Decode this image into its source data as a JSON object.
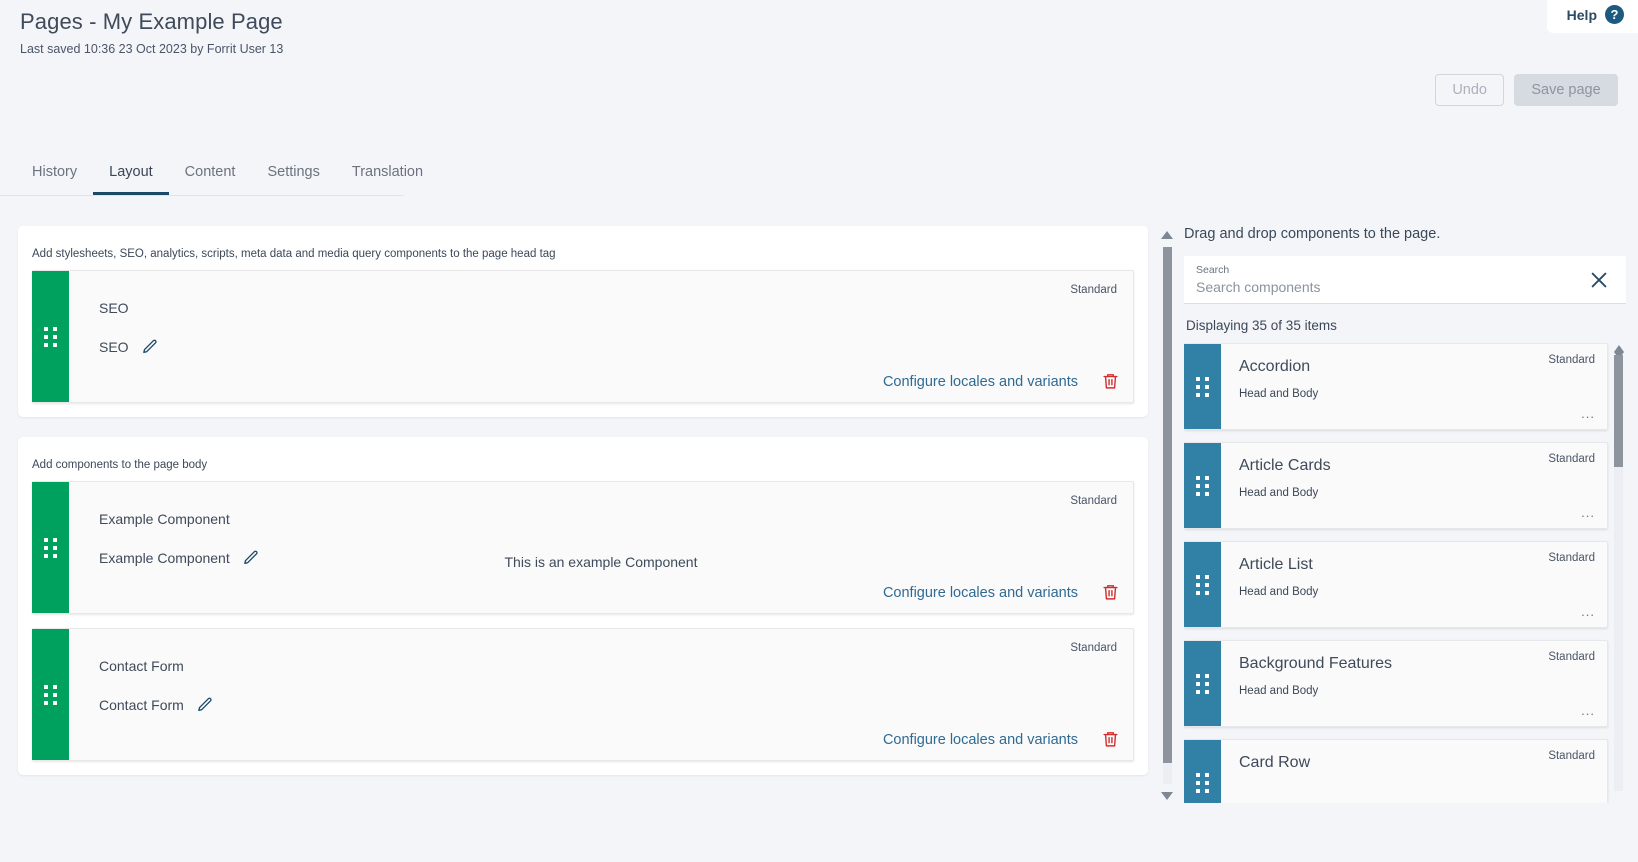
{
  "header": {
    "title": "Pages - My Example Page",
    "subtitle": "Last saved 10:36 23 Oct 2023 by Forrit User 13",
    "help_label": "Help",
    "help_icon_glyph": "?"
  },
  "actions": {
    "undo_label": "Undo",
    "save_label": "Save page"
  },
  "tabs": [
    {
      "label": "History",
      "active": false
    },
    {
      "label": "Layout",
      "active": true
    },
    {
      "label": "Content",
      "active": false
    },
    {
      "label": "Settings",
      "active": false
    },
    {
      "label": "Translation",
      "active": false
    }
  ],
  "sections": [
    {
      "hint": "Add stylesheets, SEO, analytics, scripts, meta data and media query components to the page head tag",
      "components": [
        {
          "name": "SEO",
          "label": "SEO",
          "badge": "Standard",
          "center_text": "",
          "configure_link": "Configure locales and variants"
        }
      ]
    },
    {
      "hint": "Add components to the page body",
      "components": [
        {
          "name": "Example Component",
          "label": "Example Component",
          "badge": "Standard",
          "center_text": "This is an example Component",
          "configure_link": "Configure locales and variants"
        },
        {
          "name": "Contact Form",
          "label": "Contact Form",
          "badge": "Standard",
          "center_text": "",
          "configure_link": "Configure locales and variants"
        }
      ]
    }
  ],
  "sidebar": {
    "heading": "Drag and drop components to the page.",
    "search": {
      "label": "Search",
      "placeholder": "Search components",
      "value": ""
    },
    "count_text": "Displaying 35 of 35 items",
    "items": [
      {
        "title": "Accordion",
        "subtitle": "Head and Body",
        "badge": "Standard",
        "ellipsis": "..."
      },
      {
        "title": "Article Cards",
        "subtitle": "Head and Body",
        "badge": "Standard",
        "ellipsis": "..."
      },
      {
        "title": "Article List",
        "subtitle": "Head and Body",
        "badge": "Standard",
        "ellipsis": "..."
      },
      {
        "title": "Background Features",
        "subtitle": "Head and Body",
        "badge": "Standard",
        "ellipsis": "..."
      },
      {
        "title": "Card Row",
        "subtitle": "",
        "badge": "Standard",
        "ellipsis": ""
      }
    ]
  },
  "colors": {
    "page_bg": "#f4f5f9",
    "green_handle": "#00a05f",
    "blue_handle": "#3180a5",
    "link": "#2f6a93",
    "trash_red": "#d32f2f",
    "tab_active": "#1b4a66"
  }
}
